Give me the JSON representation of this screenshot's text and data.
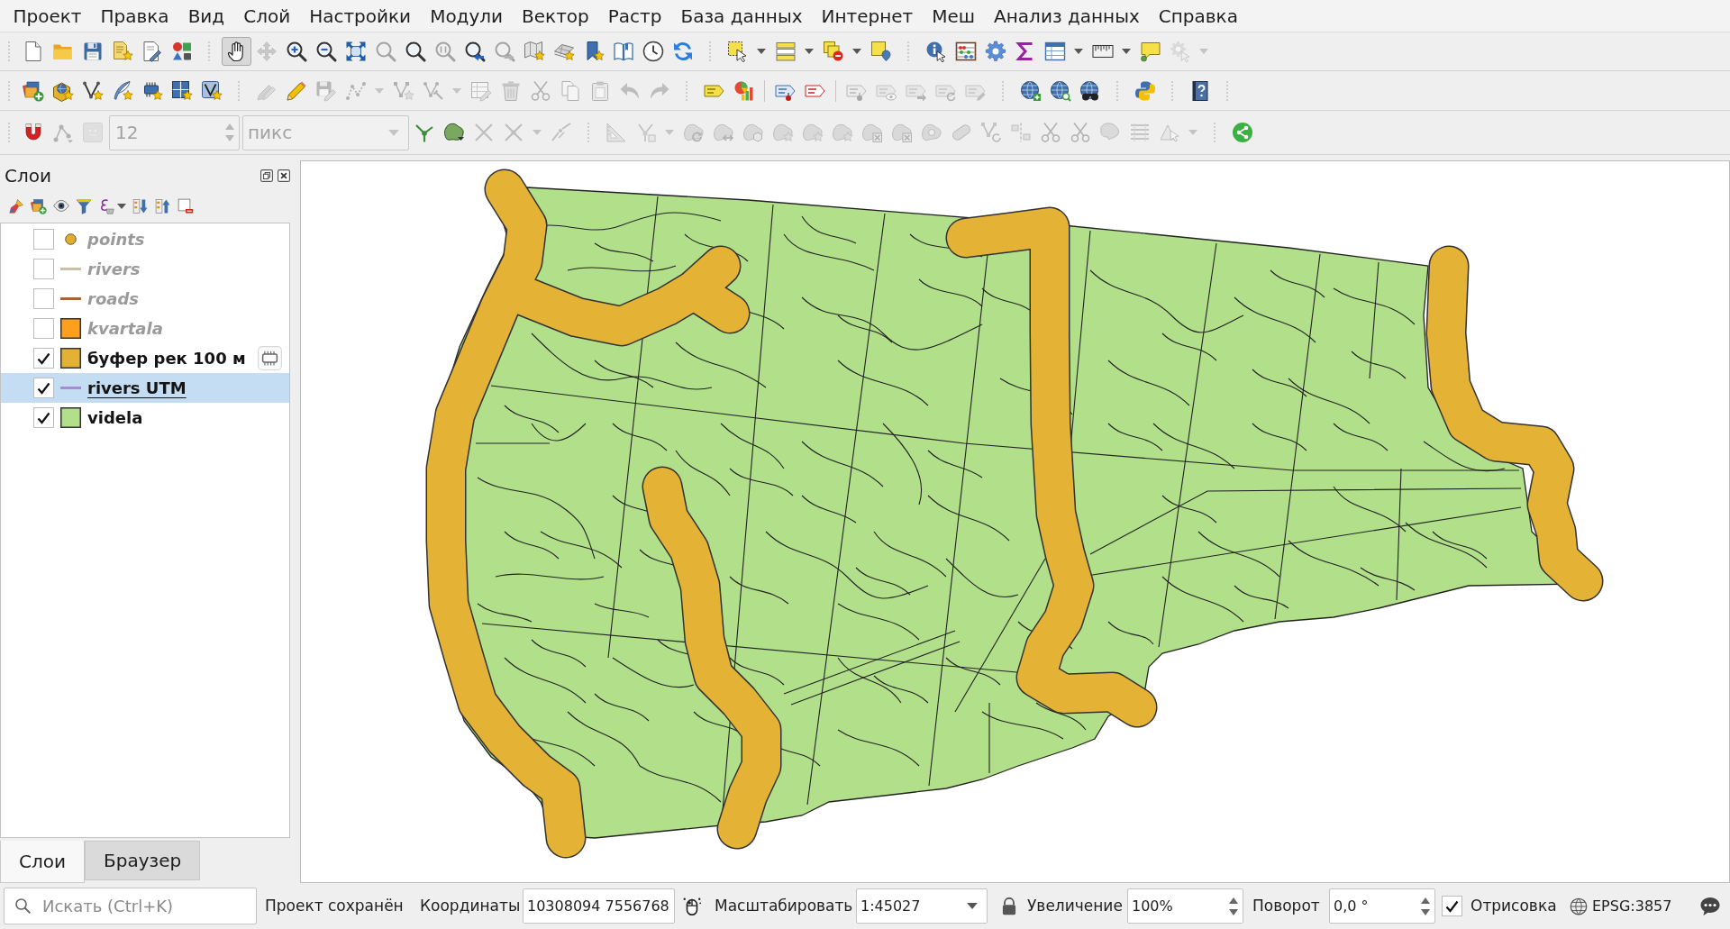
{
  "menu": [
    "Проект",
    "Правка",
    "Вид",
    "Слой",
    "Настройки",
    "Модули",
    "Вектор",
    "Растр",
    "База данных",
    "Интернет",
    "Меш",
    "Анализ данных",
    "Справка"
  ],
  "toolbars": [
    {
      "buttons": [
        {
          "disabled": false,
          "pressed": false
        },
        {
          "disabled": false,
          "pressed": false
        },
        {
          "disabled": false,
          "pressed": false
        },
        {
          "disabled": false,
          "pressed": false
        },
        {
          "disabled": false,
          "pressed": false
        },
        {
          "disabled": false,
          "pressed": false
        },
        {
          "disabled": false,
          "pressed": true
        },
        {
          "disabled": true,
          "pressed": false
        },
        {
          "disabled": false,
          "pressed": false
        },
        {
          "disabled": false,
          "pressed": false
        },
        {
          "disabled": false,
          "pressed": false
        },
        {
          "disabled": true,
          "pressed": false
        },
        {
          "disabled": false,
          "pressed": false
        },
        {
          "disabled": true,
          "pressed": false
        },
        {
          "disabled": false,
          "pressed": false
        },
        {
          "disabled": true,
          "pressed": false
        },
        {
          "disabled": false,
          "pressed": false
        },
        {
          "disabled": false,
          "pressed": false
        },
        {
          "disabled": false,
          "pressed": false
        },
        {
          "disabled": false,
          "pressed": false
        },
        {
          "disabled": false,
          "pressed": false
        },
        {
          "disabled": false,
          "pressed": false
        },
        {
          "disabled": false,
          "pressed": false
        },
        {
          "disabled": false,
          "pressed": false
        },
        {
          "disabled": false,
          "pressed": false
        },
        {
          "disabled": false,
          "pressed": false
        },
        {
          "disabled": false,
          "pressed": false
        },
        {
          "disabled": false,
          "pressed": false
        },
        {
          "disabled": false,
          "pressed": false
        },
        {
          "disabled": false,
          "pressed": false
        },
        {
          "disabled": false,
          "pressed": false
        },
        {
          "disabled": false,
          "pressed": false
        },
        {
          "disabled": false,
          "pressed": false
        },
        {
          "disabled": true,
          "pressed": false
        }
      ]
    },
    {
      "buttons": [
        {
          "disabled": false,
          "pressed": false
        },
        {
          "disabled": false,
          "pressed": false
        },
        {
          "disabled": false,
          "pressed": false
        },
        {
          "disabled": false,
          "pressed": false
        },
        {
          "disabled": false,
          "pressed": false
        },
        {
          "disabled": false,
          "pressed": false
        },
        {
          "disabled": false,
          "pressed": false
        },
        {
          "disabled": true,
          "pressed": false
        },
        {
          "disabled": false,
          "pressed": false
        },
        {
          "disabled": true,
          "pressed": false
        },
        {
          "disabled": true,
          "pressed": false
        },
        {
          "disabled": true,
          "pressed": false
        },
        {
          "disabled": true,
          "pressed": false
        },
        {
          "disabled": true,
          "pressed": false
        },
        {
          "disabled": true,
          "pressed": false
        },
        {
          "disabled": true,
          "pressed": false
        },
        {
          "disabled": true,
          "pressed": false
        },
        {
          "disabled": true,
          "pressed": false
        },
        {
          "disabled": true,
          "pressed": false
        },
        {
          "disabled": true,
          "pressed": false
        },
        {
          "disabled": false,
          "pressed": false
        },
        {
          "disabled": false,
          "pressed": false
        },
        {
          "disabled": false,
          "pressed": false
        },
        {
          "disabled": false,
          "pressed": false
        },
        {
          "disabled": true,
          "pressed": false
        },
        {
          "disabled": true,
          "pressed": false
        },
        {
          "disabled": true,
          "pressed": false
        },
        {
          "disabled": true,
          "pressed": false
        },
        {
          "disabled": true,
          "pressed": false
        },
        {
          "disabled": false,
          "pressed": false
        },
        {
          "disabled": false,
          "pressed": false
        },
        {
          "disabled": false,
          "pressed": false
        },
        {
          "disabled": false,
          "pressed": false
        },
        {
          "disabled": false,
          "pressed": false
        }
      ]
    },
    {
      "buttons": [
        {
          "disabled": false,
          "pressed": false
        },
        {
          "disabled": true,
          "pressed": false
        },
        {
          "disabled": true,
          "pressed": false
        },
        {
          "disabled": false,
          "pressed": false
        },
        {
          "disabled": false,
          "pressed": false
        },
        {
          "disabled": true,
          "pressed": false
        },
        {
          "disabled": true,
          "pressed": false
        },
        {
          "disabled": true,
          "pressed": false
        },
        {
          "disabled": true,
          "pressed": false
        },
        {
          "disabled": true,
          "pressed": false
        },
        {
          "disabled": true,
          "pressed": false
        },
        {
          "disabled": true,
          "pressed": false
        },
        {
          "disabled": true,
          "pressed": false
        },
        {
          "disabled": true,
          "pressed": false
        },
        {
          "disabled": true,
          "pressed": false
        },
        {
          "disabled": true,
          "pressed": false
        },
        {
          "disabled": true,
          "pressed": false
        },
        {
          "disabled": true,
          "pressed": false
        },
        {
          "disabled": true,
          "pressed": false
        },
        {
          "disabled": true,
          "pressed": false
        },
        {
          "disabled": true,
          "pressed": false
        },
        {
          "disabled": true,
          "pressed": false
        },
        {
          "disabled": true,
          "pressed": false
        },
        {
          "disabled": true,
          "pressed": false
        },
        {
          "disabled": true,
          "pressed": false
        },
        {
          "disabled": true,
          "pressed": false
        },
        {
          "disabled": true,
          "pressed": false
        },
        {
          "disabled": false,
          "pressed": false
        }
      ],
      "tolerance": {
        "value": "12",
        "disabled": true
      },
      "units": {
        "value": "пикс",
        "disabled": true
      }
    }
  ],
  "layers_panel": {
    "title": "Слои",
    "layers": [
      {
        "name": "points",
        "kind": "point",
        "color": "#e2ac2e",
        "checked": false,
        "selected": false,
        "underlined": false,
        "temporary": false
      },
      {
        "name": "rivers",
        "kind": "line",
        "color": "#cbbfa6",
        "checked": false,
        "selected": false,
        "underlined": false,
        "temporary": false
      },
      {
        "name": "roads",
        "kind": "line",
        "color": "#a5633d",
        "checked": false,
        "selected": false,
        "underlined": false,
        "temporary": false
      },
      {
        "name": "kvartala",
        "kind": "fill",
        "color": "#ff9f1c",
        "checked": false,
        "selected": false,
        "underlined": false,
        "temporary": false
      },
      {
        "name": "буфер рек 100 м",
        "kind": "fill",
        "color": "#e3b234",
        "checked": true,
        "selected": false,
        "underlined": false,
        "temporary": true
      },
      {
        "name": "rivers UTM",
        "kind": "line",
        "color": "#a98bd2",
        "checked": true,
        "selected": true,
        "underlined": true,
        "temporary": false
      },
      {
        "name": "videla",
        "kind": "fill",
        "color": "#b2df8a",
        "checked": true,
        "selected": false,
        "underlined": false,
        "temporary": false
      }
    ],
    "tabs": [
      {
        "label": "Слои",
        "selected": true
      },
      {
        "label": "Браузер",
        "selected": false
      }
    ]
  },
  "status_bar": {
    "search": {
      "placeholder": "Искать (Ctrl+K)"
    },
    "message": "Проект сохранён",
    "coordinates": {
      "label": "Координаты",
      "value": "10308094 7556768"
    },
    "scale": {
      "label": "Масштабировать",
      "value": "1:45027"
    },
    "magnifier": {
      "label": "Увеличение",
      "value": "100%"
    },
    "rotation": {
      "label": "Поворот",
      "value": "0,0 °"
    },
    "render": {
      "label": "Отрисовка",
      "checked": true
    },
    "crs": "EPSG:3857"
  }
}
